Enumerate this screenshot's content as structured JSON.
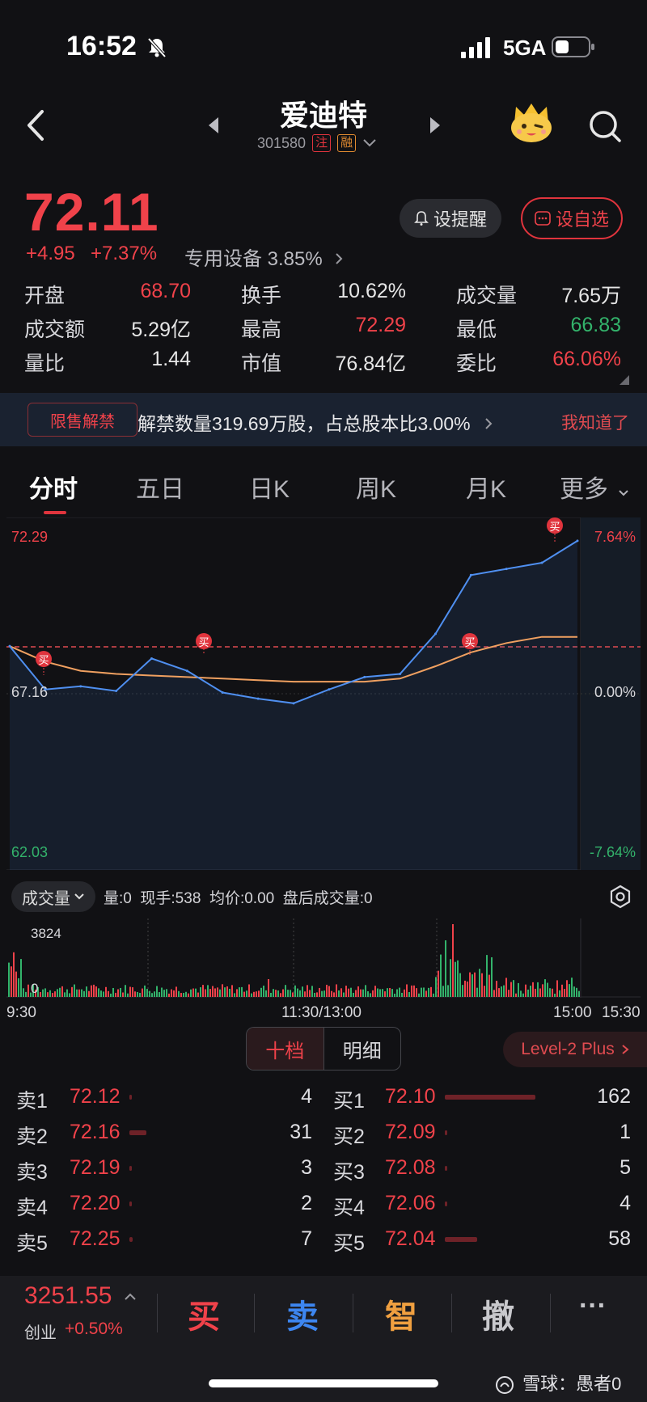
{
  "status": {
    "time": "16:52",
    "network": "5GA"
  },
  "header": {
    "title": "爱迪特",
    "code": "301580",
    "tag1": "注",
    "tag2": "融"
  },
  "quote": {
    "price": "72.11",
    "change": "+4.95",
    "change_pct": "+7.37%",
    "sector": "专用设备 3.85%",
    "alert_label": "设提醒",
    "watch_label": "设自选"
  },
  "stats": [
    {
      "label": "开盘",
      "value": "68.70",
      "color": "#f0424a"
    },
    {
      "label": "换手",
      "value": "10.62%",
      "color": "#e6e6e6"
    },
    {
      "label": "成交量",
      "value": "7.65万",
      "color": "#e6e6e6"
    },
    {
      "label": "成交额",
      "value": "5.29亿",
      "color": "#e6e6e6"
    },
    {
      "label": "最高",
      "value": "72.29",
      "color": "#f0424a"
    },
    {
      "label": "最低",
      "value": "66.83",
      "color": "#33b36b"
    },
    {
      "label": "量比",
      "value": "1.44",
      "color": "#e6e6e6"
    },
    {
      "label": "市值",
      "value": "76.84亿",
      "color": "#e6e6e6"
    },
    {
      "label": "委比",
      "value": "66.06%",
      "color": "#f0424a"
    }
  ],
  "banner": {
    "tag": "限售解禁",
    "text": "解禁数量319.69万股，占总股本比3.00%",
    "ok": "我知道了"
  },
  "tabs": [
    "分时",
    "五日",
    "日K",
    "周K",
    "月K",
    "更多"
  ],
  "chart": {
    "y_top": "72.29",
    "y_mid": "67.16",
    "y_bot": "62.03",
    "pct_top": "7.64%",
    "pct_mid": "0.00%",
    "pct_bot": "-7.64%",
    "buy_marker": "买"
  },
  "chart_data": {
    "type": "line",
    "title": "",
    "xlabel": "",
    "ylabel": "",
    "x": [
      "9:30",
      "9:45",
      "10:00",
      "10:15",
      "10:30",
      "10:45",
      "11:00",
      "11:15",
      "11:30",
      "13:15",
      "13:30",
      "13:45",
      "14:00",
      "14:15",
      "14:30",
      "14:45",
      "15:00"
    ],
    "ylim": [
      62.03,
      72.29
    ],
    "series": [
      {
        "values": [
          68.7,
          67.3,
          67.4,
          67.25,
          68.3,
          67.9,
          67.2,
          67.0,
          66.85,
          67.3,
          67.7,
          67.8,
          69.1,
          71.0,
          71.2,
          71.4,
          72.11
        ]
      },
      {
        "values": [
          68.7,
          68.2,
          67.9,
          67.8,
          67.75,
          67.7,
          67.65,
          67.6,
          67.55,
          67.55,
          67.55,
          67.65,
          68.05,
          68.5,
          68.8,
          69.0,
          69.0
        ]
      }
    ]
  },
  "volume": {
    "selector": "成交量",
    "info": "量:0  现手:538  均价:0.00  盘后成交量:0",
    "max": "3824",
    "zero": "0",
    "t_start": "9:30",
    "t_mid": "11:30/13:00",
    "t_end": "15:00",
    "t_after": "15:30"
  },
  "orderbook": {
    "tab_active": "十档",
    "tab_other": "明细",
    "level2": "Level-2 Plus",
    "asks": [
      {
        "label": "卖1",
        "price": "72.12",
        "vol": "4",
        "bar": 0.02
      },
      {
        "label": "卖2",
        "price": "72.16",
        "vol": "31",
        "bar": 0.19
      },
      {
        "label": "卖3",
        "price": "72.19",
        "vol": "3",
        "bar": 0.02
      },
      {
        "label": "卖4",
        "price": "72.20",
        "vol": "2",
        "bar": 0.01
      },
      {
        "label": "卖5",
        "price": "72.25",
        "vol": "7",
        "bar": 0.04
      }
    ],
    "bids": [
      {
        "label": "买1",
        "price": "72.10",
        "vol": "162",
        "bar": 1.0
      },
      {
        "label": "买2",
        "price": "72.09",
        "vol": "1",
        "bar": 0.01
      },
      {
        "label": "买3",
        "price": "72.08",
        "vol": "5",
        "bar": 0.03
      },
      {
        "label": "买4",
        "price": "72.06",
        "vol": "4",
        "bar": 0.02
      },
      {
        "label": "买5",
        "price": "72.04",
        "vol": "58",
        "bar": 0.36
      }
    ]
  },
  "bottom": {
    "index_value": "3251.55",
    "index_name": "创业",
    "index_change": "+0.50%",
    "buy": "买",
    "sell": "卖",
    "smart": "智",
    "cancel": "撤",
    "more": "···",
    "watermark": "雪球：愚者0"
  },
  "colors": {
    "up": "#f0424a",
    "down": "#33b36b",
    "line": "#4f8ff0",
    "avg": "#f0a060",
    "bg": "#111114"
  }
}
